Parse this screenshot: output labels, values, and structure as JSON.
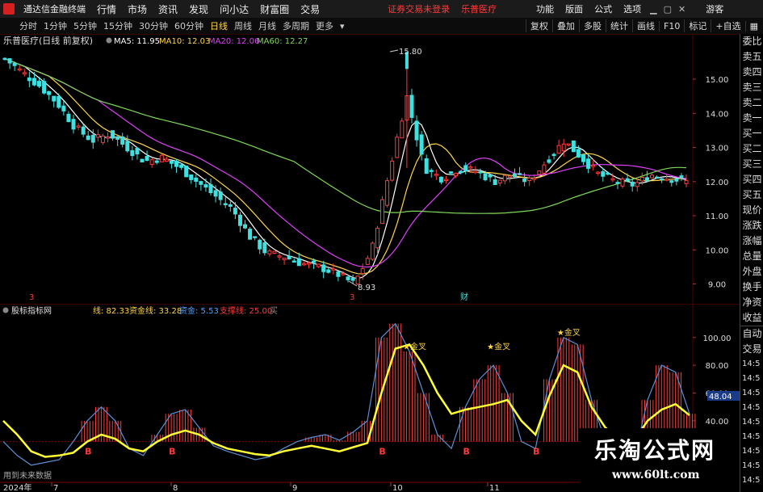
{
  "menubar": {
    "app_title": "通达信金融终端",
    "items": [
      "行情",
      "市场",
      "资讯",
      "发现",
      "问小达",
      "财富圈",
      "交易"
    ],
    "status": "证券交易未登录",
    "stock": "乐普医疗",
    "right_items": [
      "功能",
      "版面",
      "公式",
      "选项"
    ],
    "guest": "游客"
  },
  "timeframes": {
    "items": [
      "分时",
      "1分钟",
      "5分钟",
      "15分钟",
      "30分钟",
      "60分钟",
      "日线",
      "周线",
      "月线",
      "多周期",
      "更多"
    ],
    "active": "日线",
    "buttons": [
      "复权",
      "叠加",
      "多股",
      "统计",
      "画线",
      "F10",
      "标记",
      "+自选"
    ]
  },
  "main_chart": {
    "title": "乐普医疗(日线 前复权)",
    "ma_labels": [
      {
        "text": "MA5: 11.95",
        "color": "#ffffff"
      },
      {
        "text": "MA10: 12.03",
        "color": "#ffd54a"
      },
      {
        "text": "MA20: 12.06",
        "color": "#e040fb"
      },
      {
        "text": "MA60: 12.27",
        "color": "#7ed957"
      }
    ],
    "yticks": [
      "15.00",
      "14.00",
      "13.00",
      "12.00",
      "11.00",
      "10.00",
      "9.00"
    ],
    "high_label": "15.80",
    "low_label": "8.93",
    "marker_left": "3",
    "marker_mid": "3",
    "marker_right": "财"
  },
  "indicator": {
    "title": "股标指标网",
    "labels": [
      {
        "text": "线: 82.33",
        "color": "#ffd54a"
      },
      {
        "text": "资金线: 33.28",
        "color": "#ffd54a"
      },
      {
        "text": "资金: 5.53",
        "color": "#4fa3ff"
      },
      {
        "text": "支撑线: 25.00",
        "color": "#ff3b3b"
      },
      {
        "text": "买",
        "color": "#888888"
      }
    ],
    "yticks": [
      "100.00",
      "80.00",
      "60.00",
      "40.00"
    ],
    "current_value": "48.04",
    "golden_cross": "★金叉",
    "buy_signal": "B",
    "footer": "用到未来数据"
  },
  "xaxis": {
    "year_label": "2024年",
    "months": [
      "7",
      "8",
      "9",
      "10",
      "11"
    ]
  },
  "right_panel": {
    "labels": [
      "委比",
      "卖五",
      "卖四",
      "卖三",
      "卖二",
      "卖一",
      "买一",
      "买二",
      "买三",
      "买四",
      "买五",
      "现价",
      "涨跌",
      "涨幅",
      "总量",
      "外盘",
      "换手",
      "净资",
      "收益"
    ],
    "trade_head": [
      "自动",
      "交易"
    ],
    "times": [
      "14:5",
      "14:5",
      "14:5",
      "14:5",
      "14:5",
      "14:5",
      "14:5",
      "14:5",
      "14:5"
    ]
  },
  "watermark": {
    "title": "乐淘公式网",
    "url": "www.60lt.com"
  },
  "colors": {
    "up": "#ff3b3b",
    "down": "#40e0e0",
    "ma5": "#ffffff",
    "ma10": "#ffd54a",
    "ma20": "#e040fb",
    "ma60": "#7ed957",
    "yellow_line": "#ffff33",
    "blue_line": "#5a8fd6",
    "grid": "#5a0000"
  },
  "chart_data": [
    {
      "type": "candlestick",
      "title": "乐普医疗(日线 前复权)",
      "ylim": [
        8.8,
        15.9
      ],
      "annotations": [
        {
          "label": "15.80",
          "value": 15.8
        },
        {
          "label": "8.93",
          "value": 8.93
        }
      ],
      "x": [
        "2024-06",
        "2024-07",
        "2024-08",
        "2024-09",
        "2024-10",
        "2024-11"
      ],
      "close_path": [
        15.6,
        15.2,
        14.8,
        14.3,
        13.6,
        13.2,
        13.4,
        13.0,
        12.6,
        12.7,
        12.4,
        12.0,
        11.6,
        11.2,
        10.4,
        9.9,
        9.8,
        9.6,
        9.5,
        9.3,
        9.0,
        10.0,
        12.3,
        14.5,
        12.4,
        12.1,
        12.4,
        12.3,
        12.0,
        12.2,
        12.0,
        12.6,
        13.2,
        12.7,
        12.2,
        12.0,
        11.9,
        12.2,
        12.1,
        12.0
      ],
      "ma5_last": 11.95,
      "ma10_last": 12.03,
      "ma20_last": 12.06,
      "ma60_last": 12.27
    },
    {
      "type": "line",
      "title": "股标指标网",
      "ylim": [
        5,
        115
      ],
      "series": [
        {
          "name": "资金线",
          "values": [
            40,
            30,
            18,
            14,
            15,
            17,
            25,
            30,
            27,
            20,
            18,
            25,
            30,
            33,
            30,
            24,
            20,
            18,
            16,
            15,
            18,
            20,
            22,
            20,
            18,
            21,
            24,
            60,
            92,
            95,
            80,
            60,
            45,
            48,
            50,
            52,
            55,
            40,
            30,
            58,
            80,
            75,
            50,
            35,
            28,
            25,
            40,
            48,
            52,
            44
          ]
        },
        {
          "name": "资金",
          "values": [
            25,
            15,
            8,
            10,
            12,
            25,
            40,
            50,
            40,
            20,
            15,
            30,
            45,
            48,
            35,
            22,
            18,
            15,
            12,
            14,
            20,
            25,
            28,
            30,
            26,
            32,
            40,
            100,
            110,
            90,
            60,
            30,
            20,
            50,
            70,
            80,
            60,
            25,
            20,
            70,
            100,
            95,
            55,
            25,
            15,
            10,
            55,
            80,
            75,
            45
          ]
        },
        {
          "name": "支撑线",
          "values": [
            25,
            25,
            25,
            25,
            25,
            25,
            25,
            25,
            25,
            25,
            25,
            25,
            25,
            25,
            25,
            25,
            25,
            25,
            25,
            25,
            25,
            25,
            25,
            25,
            25,
            25,
            25,
            25,
            25,
            25,
            25,
            25,
            25,
            25,
            25,
            25,
            25,
            25,
            25,
            25,
            25,
            25,
            25,
            25,
            25,
            25,
            25,
            25,
            25,
            25
          ]
        }
      ]
    }
  ]
}
